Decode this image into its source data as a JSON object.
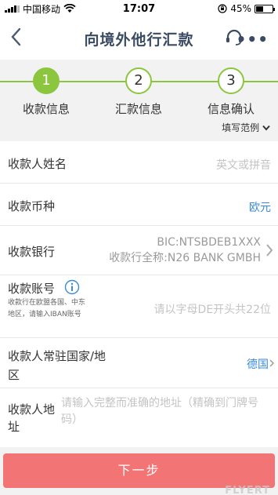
{
  "status_bar": {
    "carrier": "中国移动",
    "time": "17:07",
    "battery": "45%",
    "battery_level": 0.45
  },
  "header": {
    "back_icon": "chevron-left-icon",
    "title": "向境外他行汇款",
    "service_icon": "headset-icon",
    "more_icon": "more-icon"
  },
  "steps": [
    {
      "number": "1",
      "label": "收款信息",
      "active": true
    },
    {
      "number": "2",
      "label": "汇款信息",
      "active": false
    },
    {
      "number": "3",
      "label": "信息确认",
      "active": false
    }
  ],
  "example_link": "填写范例",
  "form": {
    "payee_name": {
      "label": "收款人姓名",
      "placeholder": "英文或拼音"
    },
    "currency": {
      "label": "收款币种",
      "value": "欧元"
    },
    "bank": {
      "label": "收款银行",
      "bic": "BIC:NTSBDEB1XXX",
      "full_name": "收款行全称:N26 BANK GMBH"
    },
    "account": {
      "label": "收款账号",
      "hint": "收款行在欧盟各国、中东地区，请输入IBAN账号",
      "placeholder": "请以字母DE开头共22位"
    },
    "country": {
      "label": "收款人常驻国家/地区",
      "value": "德国"
    },
    "address": {
      "label": "收款人地址",
      "placeholder": "请输入完整而准确的地址（精确到门牌号码）"
    }
  },
  "next_button": "下一步",
  "watermark": "FLYERT",
  "colors": {
    "accent_green": "#8cc63f",
    "link_blue": "#3a8ad8",
    "button_red": "#f27474"
  }
}
